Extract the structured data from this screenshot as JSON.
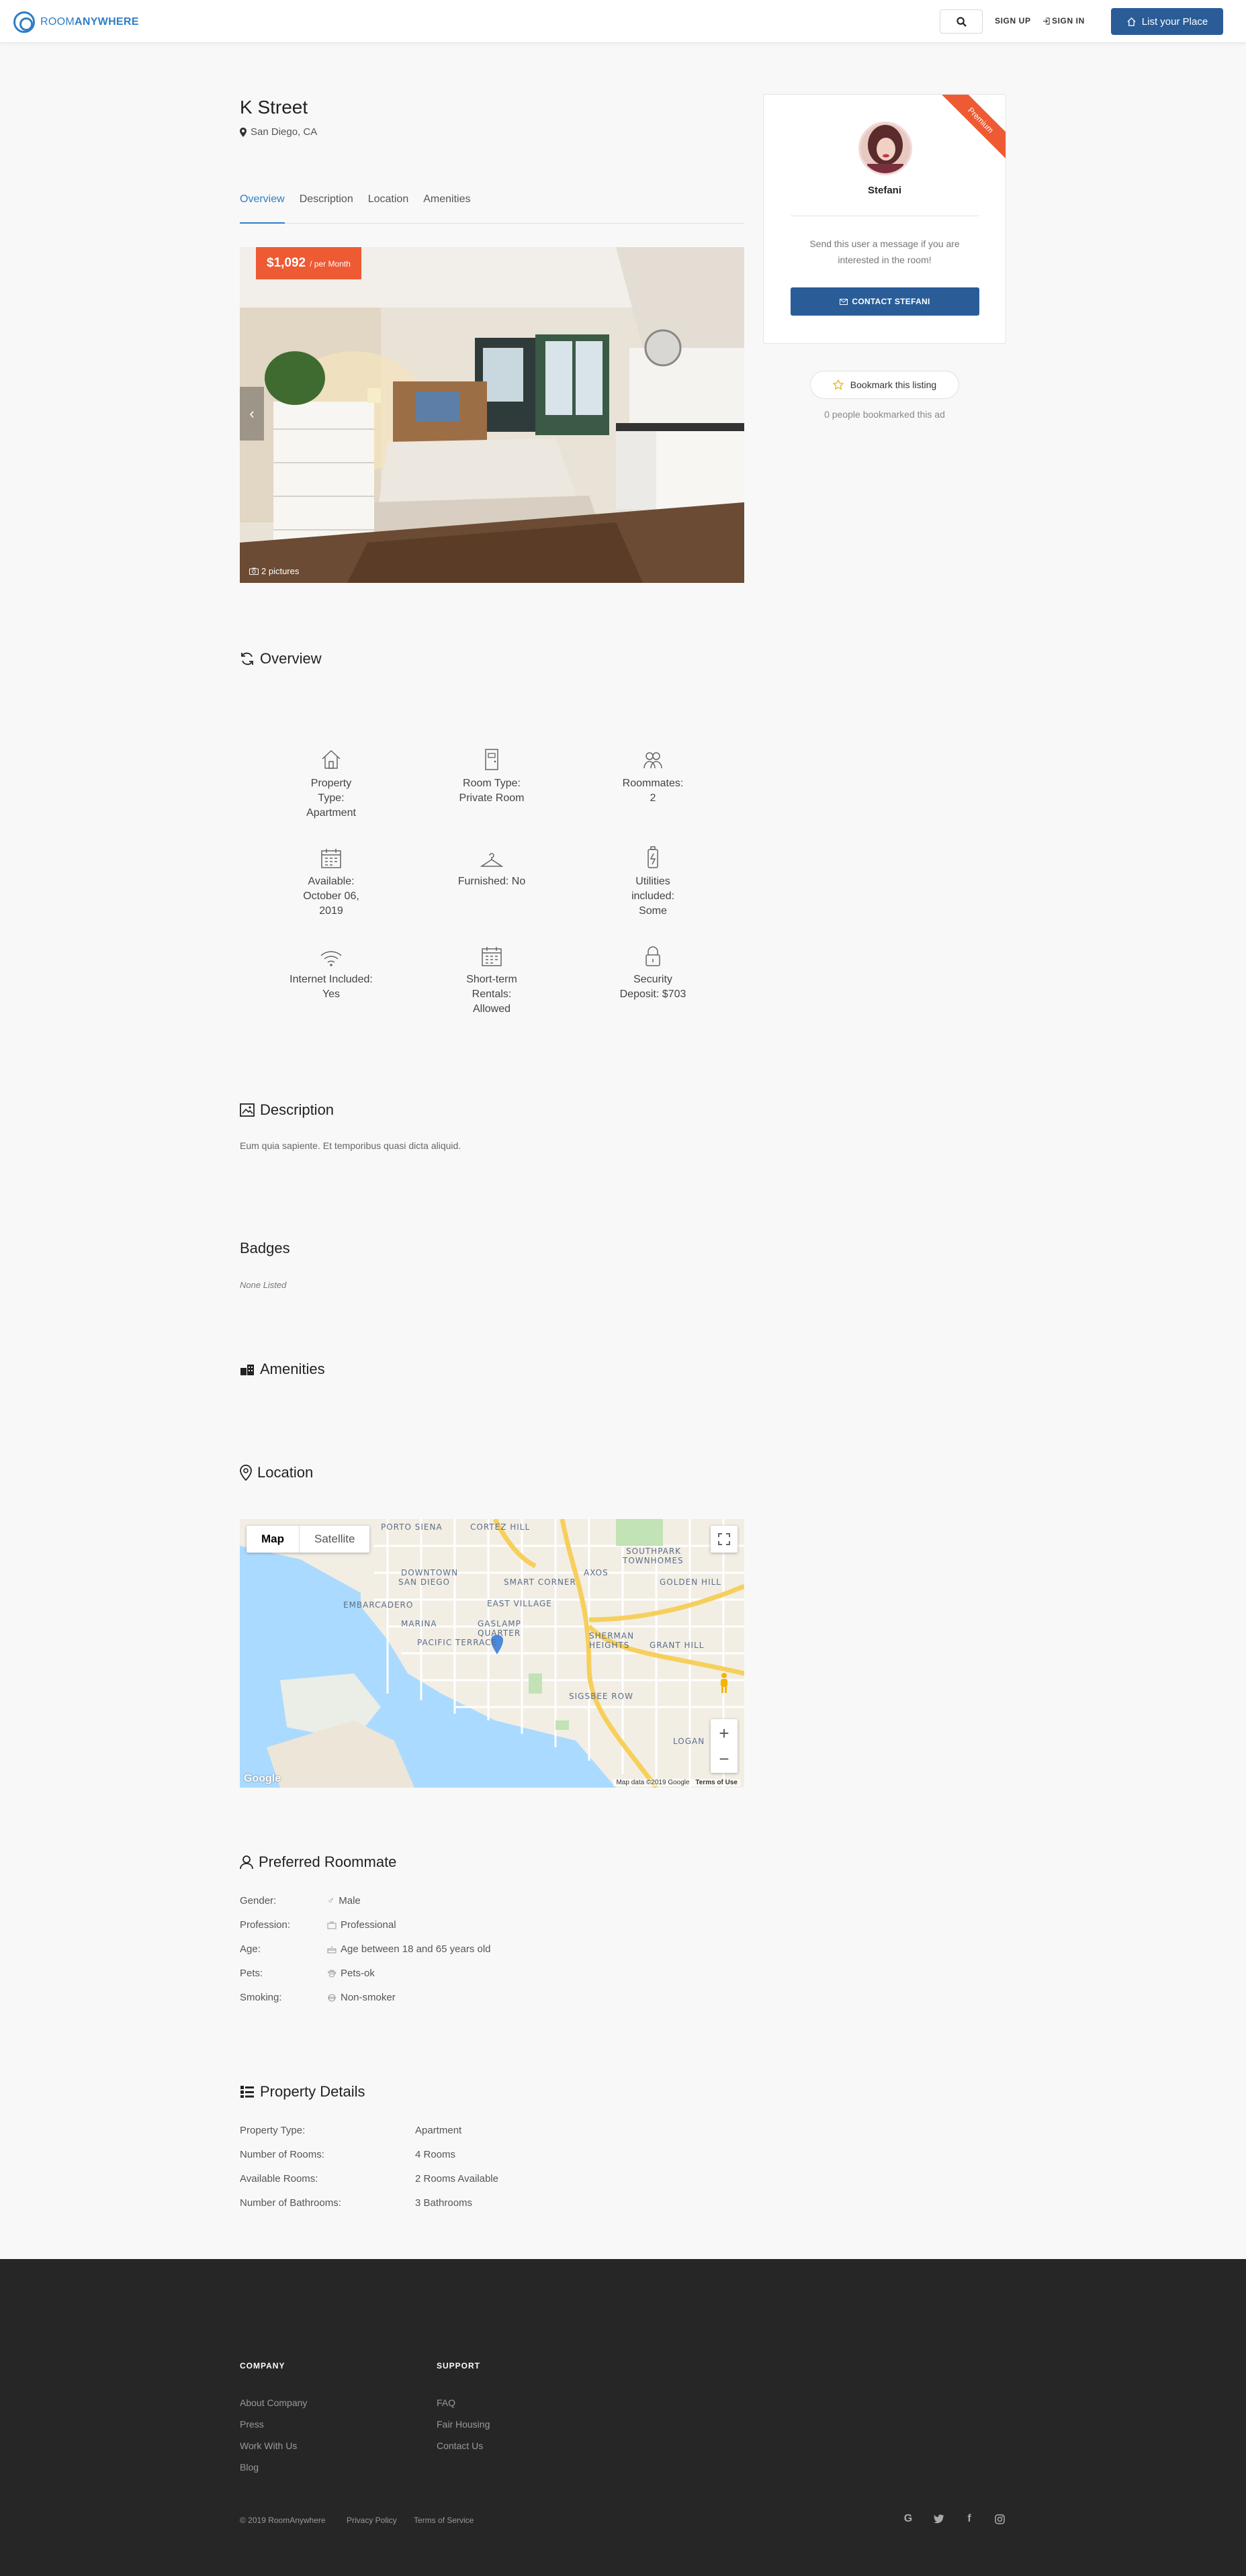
{
  "header": {
    "logo_room": "ROOM",
    "logo_anywhere": "ANYWHERE",
    "sign_up": "SIGN UP",
    "sign_in": "SIGN IN",
    "list_place": "List your Place"
  },
  "listing": {
    "title": "K Street",
    "location": "San Diego, CA",
    "price": "$1,092",
    "price_period": "/ per Month",
    "pictures": "2 pictures"
  },
  "tabs": [
    "Overview",
    "Description",
    "Location",
    "Amenities"
  ],
  "host": {
    "ribbon": "Premium",
    "name": "Stefani",
    "message": "Send this user a message if you are interested in the room!",
    "contact_label": "CONTACT STEFANI",
    "bookmark_label": "Bookmark this listing",
    "bookmark_count": "0 people bookmarked this ad"
  },
  "overview": {
    "heading": "Overview",
    "features": [
      {
        "icon": "house-icon",
        "text": "Property Type: Apartment"
      },
      {
        "icon": "door-icon",
        "text": "Room Type: Private Room"
      },
      {
        "icon": "roommates-icon",
        "text": "Roommates: 2"
      },
      {
        "icon": "calendar-icon",
        "text": "Available: October 06, 2019"
      },
      {
        "icon": "hanger-icon",
        "text": "Furnished: No"
      },
      {
        "icon": "battery-icon",
        "text": "Utilities included: Some"
      },
      {
        "icon": "wifi-icon",
        "text": "Internet Included: Yes"
      },
      {
        "icon": "calendar-icon",
        "text": "Short-term Rentals: Allowed"
      },
      {
        "icon": "lock-icon",
        "text": "Security Deposit: $703"
      }
    ]
  },
  "description": {
    "heading": "Description",
    "text": "Eum quia sapiente. Et temporibus quasi dicta aliquid."
  },
  "badges": {
    "heading": "Badges",
    "none": "None Listed"
  },
  "amenities": {
    "heading": "Amenities"
  },
  "location": {
    "heading": "Location",
    "map_label": "Map",
    "satellite_label": "Satellite",
    "map_data": "Map data ©2019 Google",
    "terms": "Terms of Use",
    "google": "Google",
    "zoom_in": "+",
    "zoom_out": "−",
    "map_labels": [
      "PORTO SIENA",
      "CORTEZ HILL",
      "DOWNTOWN SAN DIEGO",
      "SMART CORNER",
      "AXOS",
      "SOUTHPARK TOWNHOMES",
      "GOLDEN HILL",
      "EMBARCADERO",
      "EAST VILLAGE",
      "MARINA",
      "GASLAMP QUARTER",
      "PACIFIC TERRACE",
      "SHERMAN HEIGHTS",
      "GRANT HILL",
      "SIGSBEE ROW",
      "LOGAN"
    ]
  },
  "roommate": {
    "heading": "Preferred Roommate",
    "rows": [
      {
        "label": "Gender:",
        "icon": "male-icon",
        "value": "Male"
      },
      {
        "label": "Profession:",
        "icon": "briefcase-icon",
        "value": "Professional"
      },
      {
        "label": "Age:",
        "icon": "cake-icon",
        "value": "Age between 18 and 65 years old"
      },
      {
        "label": "Pets:",
        "icon": "paw-icon",
        "value": "Pets-ok"
      },
      {
        "label": "Smoking:",
        "icon": "no-smoking-icon",
        "value": "Non-smoker"
      }
    ]
  },
  "property": {
    "heading": "Property Details",
    "rows": [
      {
        "label": "Property Type:",
        "value": "Apartment"
      },
      {
        "label": "Number of Rooms:",
        "value": "4 Rooms"
      },
      {
        "label": "Available Rooms:",
        "value": "2 Rooms Available"
      },
      {
        "label": "Number of Bathrooms:",
        "value": "3 Bathrooms"
      }
    ]
  },
  "footer": {
    "company_heading": "COMPANY",
    "company_links": [
      "About Company",
      "Press",
      "Work With Us",
      "Blog"
    ],
    "support_heading": "SUPPORT",
    "support_links": [
      "FAQ",
      "Fair Housing",
      "Contact Us"
    ],
    "copyright": "© 2019 RoomAnywhere",
    "privacy": "Privacy Policy",
    "terms": "Terms of Service",
    "social": [
      "G",
      "twitter-icon",
      "f",
      "instagram-icon"
    ]
  },
  "colors": {
    "accent": "#2f7ec6",
    "button": "#2a5d98",
    "price": "#ee5a33",
    "footer": "#262626"
  }
}
